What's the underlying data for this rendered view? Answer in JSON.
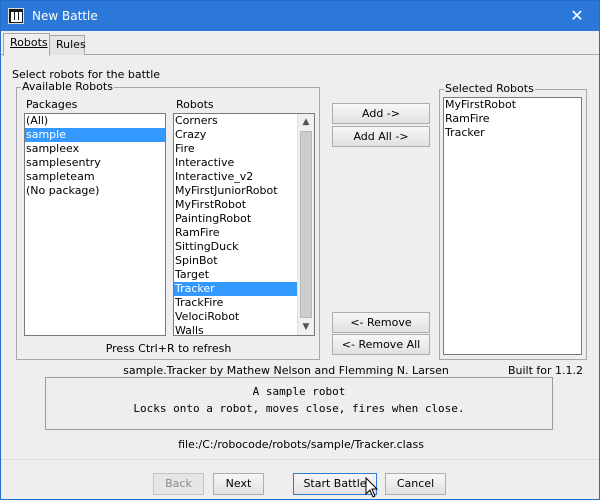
{
  "window": {
    "title": "New Battle",
    "close_glyph": "✕"
  },
  "tabs": [
    {
      "label": "Robots",
      "active": true
    },
    {
      "label": "Rules",
      "active": false
    }
  ],
  "robots_tab": {
    "hint": "Select robots for the battle",
    "available_group": "Available Robots",
    "packages_label": "Packages",
    "robots_label": "Robots",
    "packages": [
      "(All)",
      "sample",
      "sampleex",
      "samplesentry",
      "sampleteam",
      "(No package)"
    ],
    "selected_package": "sample",
    "robots": [
      "Corners",
      "Crazy",
      "Fire",
      "Interactive",
      "Interactive_v2",
      "MyFirstJuniorRobot",
      "MyFirstRobot",
      "PaintingRobot",
      "RamFire",
      "SittingDuck",
      "SpinBot",
      "Target",
      "Tracker",
      "TrackFire",
      "VelociRobot",
      "Walls"
    ],
    "selected_robot": "Tracker",
    "refresh_hint": "Press Ctrl+R to refresh",
    "add_button": "Add ->",
    "add_all_button": "Add All ->",
    "remove_button": "<- Remove",
    "remove_all_button": "<- Remove All",
    "selected_group": "Selected Robots",
    "selected_robots": [
      "MyFirstRobot",
      "RamFire",
      "Tracker"
    ]
  },
  "robot_info": {
    "author_line": "sample.Tracker by Mathew Nelson and Flemming N. Larsen",
    "built_for": "Built for 1.1.2",
    "description_lines": [
      "A sample robot",
      "Locks onto a robot, moves close, fires when close."
    ],
    "file_path": "file:/C:/robocode/robots/sample/Tracker.class"
  },
  "footer": {
    "back": "Back",
    "next": "Next",
    "start": "Start Battle",
    "cancel": "Cancel"
  },
  "icons": {
    "app": "robocode-app-icon",
    "close": "close-icon",
    "scroll_up": "scroll-up-arrow-icon",
    "scroll_down": "scroll-down-arrow-icon",
    "cursor": "mouse-pointer-icon"
  },
  "colors": {
    "titlebar": "#2b78d8",
    "selection": "#3399ff"
  }
}
